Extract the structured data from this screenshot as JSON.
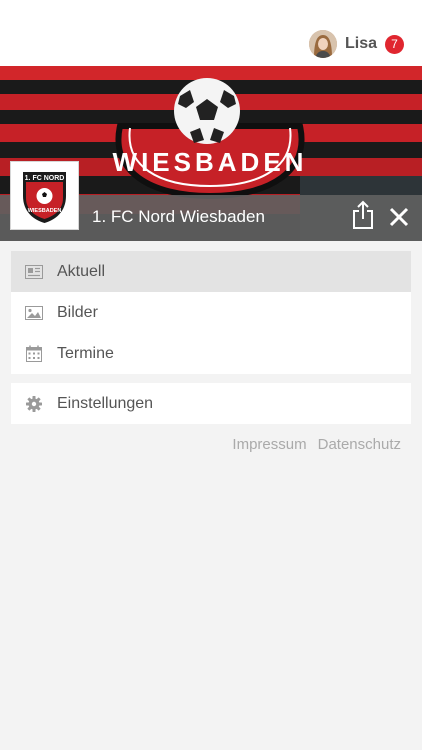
{
  "user": {
    "name": "Lisa",
    "notification_count": "7"
  },
  "club": {
    "name": "1. FC Nord Wiesbaden",
    "logo_text_top": "1. FC NORD",
    "logo_text_bottom": "WIESBADEN"
  },
  "banner": {
    "text": "WIESBADEN"
  },
  "menu": [
    {
      "label": "Aktuell",
      "icon": "newspaper-icon",
      "active": true
    },
    {
      "label": "Bilder",
      "icon": "image-icon",
      "active": false
    },
    {
      "label": "Termine",
      "icon": "calendar-icon",
      "active": false
    }
  ],
  "settings": {
    "label": "Einstellungen",
    "icon": "gear-icon"
  },
  "footer": {
    "impressum": "Impressum",
    "datenschutz": "Datenschutz"
  },
  "colors": {
    "badge": "#e0262f",
    "club_bar": "#5f5f5f",
    "active_item": "#e3e3e3",
    "banner_red": "#c62127"
  }
}
